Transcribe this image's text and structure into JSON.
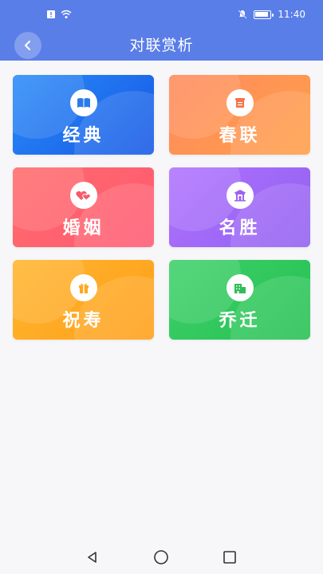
{
  "status_bar": {
    "time": "11:40",
    "battery_level": 0.9,
    "icons": [
      "alert-icon",
      "wifi-icon",
      "silent-icon",
      "battery-icon"
    ]
  },
  "header": {
    "title": "对联赏析",
    "bg_color": "#5a7ee8"
  },
  "cards": [
    {
      "label": "经典",
      "icon": "book-icon",
      "grad_from": "#2b8cf7",
      "grad_to": "#1557e6",
      "icon_color": "#2a7be8"
    },
    {
      "label": "春联",
      "icon": "scroll-icon",
      "grad_from": "#ff8a5e",
      "grad_to": "#ff9f48",
      "icon_color": "#f5744a"
    },
    {
      "label": "婚姻",
      "icon": "hearts-icon",
      "grad_from": "#ff6b6b",
      "grad_to": "#ff5a73",
      "icon_color": "#f45c6b"
    },
    {
      "label": "名胜",
      "icon": "temple-icon",
      "grad_from": "#b072ff",
      "grad_to": "#9160f0",
      "icon_color": "#9e63ef"
    },
    {
      "label": "祝寿",
      "icon": "gift-icon",
      "grad_from": "#ffb52e",
      "grad_to": "#ff9f1a",
      "icon_color": "#ffa81e"
    },
    {
      "label": "乔迁",
      "icon": "building-icon",
      "grad_from": "#3ed06a",
      "grad_to": "#25c152",
      "icon_color": "#2ebd59"
    }
  ]
}
